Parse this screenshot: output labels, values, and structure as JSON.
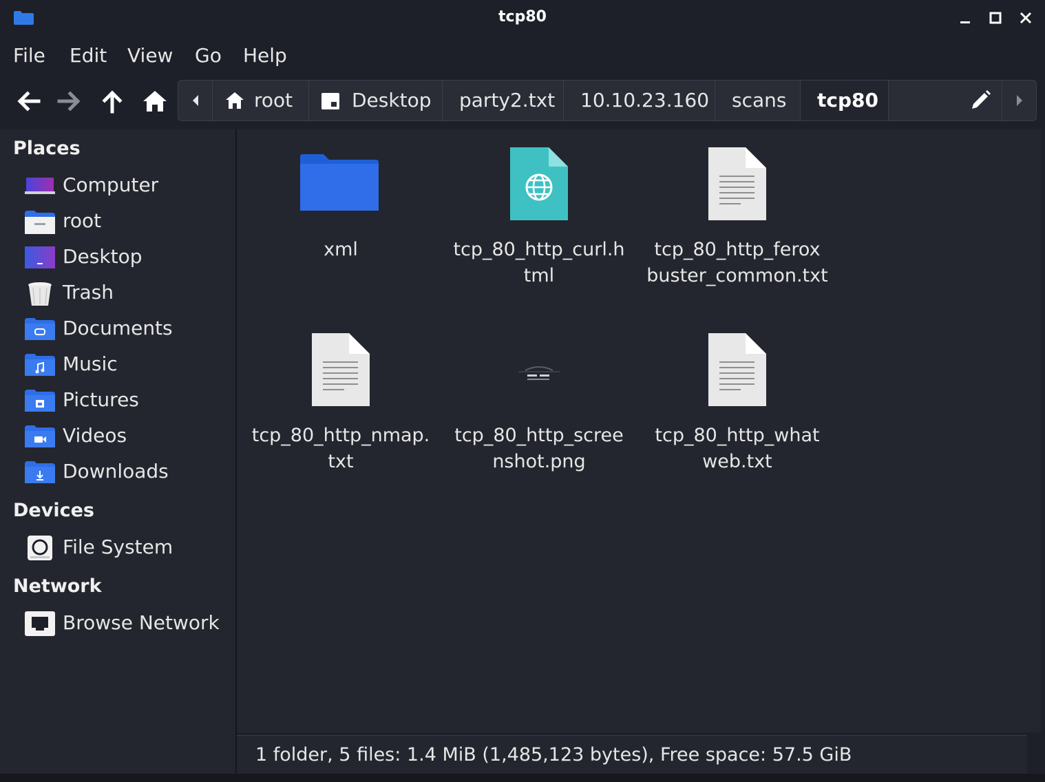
{
  "window": {
    "title": "tcp80"
  },
  "menu": [
    "File",
    "Edit",
    "View",
    "Go",
    "Help"
  ],
  "toolbar": {
    "back_icon": "arrow-left-icon",
    "forward_icon": "arrow-right-icon",
    "up_icon": "arrow-up-icon",
    "home_icon": "home-icon"
  },
  "breadcrumbs": [
    {
      "label": "root",
      "icon": "home-icon"
    },
    {
      "label": "Desktop",
      "icon": "desktop-icon"
    },
    {
      "label": "party2.txt"
    },
    {
      "label": "10.10.23.160"
    },
    {
      "label": "scans"
    },
    {
      "label": "tcp80",
      "active": true
    }
  ],
  "sidebar": {
    "places_header": "Places",
    "places": [
      {
        "label": "Computer",
        "icon": "computer-icon"
      },
      {
        "label": "root",
        "icon": "home-folder-icon"
      },
      {
        "label": "Desktop",
        "icon": "desktop-icon"
      },
      {
        "label": "Trash",
        "icon": "trash-icon"
      },
      {
        "label": "Documents",
        "icon": "documents-folder-icon"
      },
      {
        "label": "Music",
        "icon": "music-folder-icon"
      },
      {
        "label": "Pictures",
        "icon": "pictures-folder-icon"
      },
      {
        "label": "Videos",
        "icon": "videos-folder-icon"
      },
      {
        "label": "Downloads",
        "icon": "downloads-folder-icon"
      }
    ],
    "devices_header": "Devices",
    "devices": [
      {
        "label": "File System",
        "icon": "drive-icon"
      }
    ],
    "network_header": "Network",
    "network": [
      {
        "label": "Browse Network",
        "icon": "network-icon"
      }
    ]
  },
  "files": [
    {
      "name": "xml",
      "icon": "folder-icon"
    },
    {
      "name": "tcp_80_http_curl.h\ntml",
      "icon": "html-file-icon"
    },
    {
      "name": "tcp_80_http_ferox\nbuster_common.txt",
      "icon": "text-file-icon"
    },
    {
      "name": "tcp_80_http_nmap.\ntxt",
      "icon": "text-file-icon"
    },
    {
      "name": "tcp_80_http_scree\nnshot.png",
      "icon": "image-file-icon"
    },
    {
      "name": "tcp_80_http_what\nweb.txt",
      "icon": "text-file-icon"
    }
  ],
  "status": {
    "text": "1 folder, 5 files: 1.4 MiB (1,485,123 bytes), Free space: 57.5 GiB"
  },
  "colors": {
    "background": "#1d2028",
    "panel": "#23262e",
    "accent_folder": "#2f6ee8",
    "html_icon": "#3fc1c3"
  }
}
